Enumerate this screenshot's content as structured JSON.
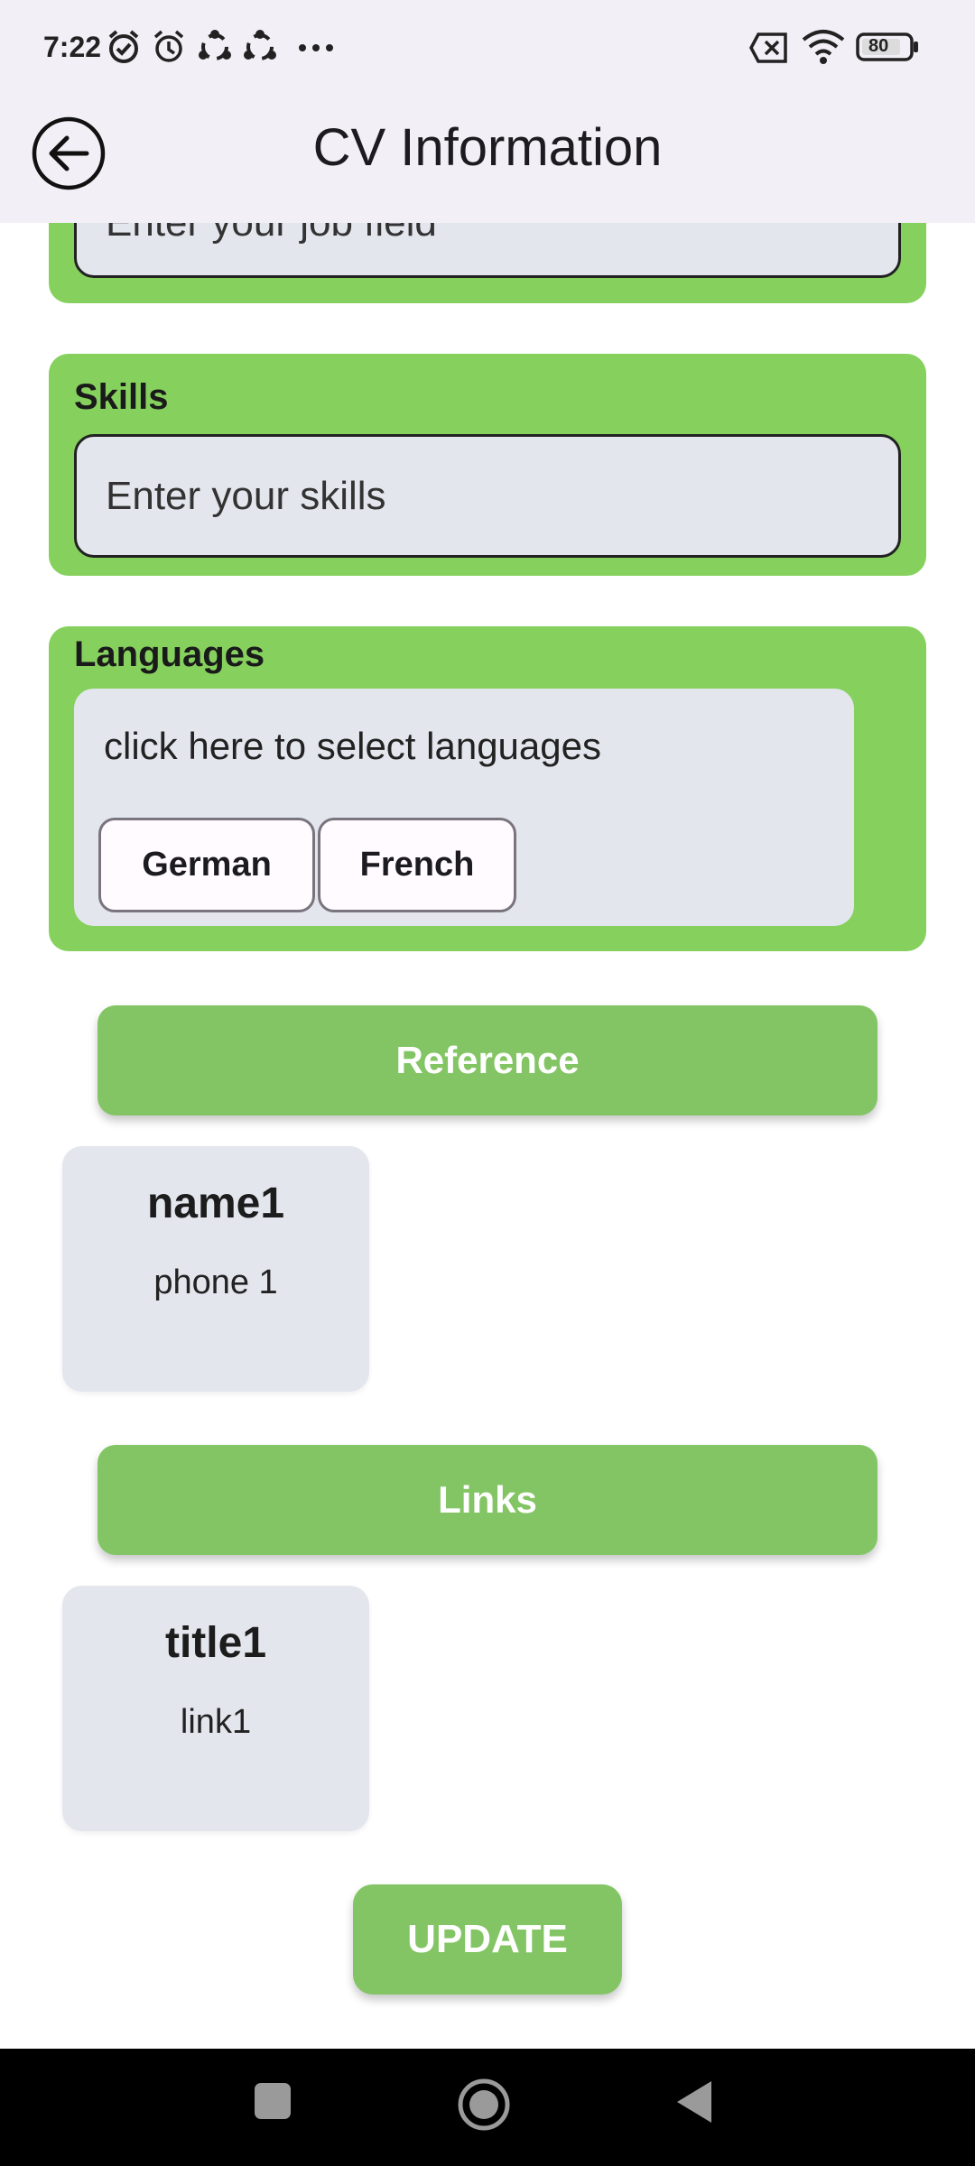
{
  "status_bar": {
    "time": "7:22",
    "left_icons": [
      "alarm-icon",
      "alarm-icon",
      "sync-icon",
      "sync-icon",
      "more-icon"
    ],
    "right_icons": [
      "sim-off-icon",
      "wifi-icon",
      "battery-icon"
    ],
    "battery_level": "80"
  },
  "app_bar": {
    "title": "CV Information",
    "back_icon": "arrow-back-icon"
  },
  "form": {
    "job_field": {
      "placeholder": "Enter your job field"
    },
    "skills": {
      "label": "Skills",
      "placeholder": "Enter your skills"
    },
    "languages": {
      "label": "Languages",
      "prompt": "click here to select languages",
      "selected": [
        "German",
        "French"
      ]
    }
  },
  "reference": {
    "button_label": "Reference",
    "items": [
      {
        "name": "name1",
        "phone": "phone 1"
      }
    ]
  },
  "links": {
    "button_label": "Links",
    "items": [
      {
        "title": "title1",
        "link": "link1"
      }
    ]
  },
  "update_label": "UPDATE",
  "nav_bar": {
    "icons": [
      "recents-icon",
      "home-icon",
      "back-triangle-icon"
    ]
  },
  "colors": {
    "accent": "#86d15e",
    "button": "#83c564",
    "field_bg": "#e4e6ee",
    "app_bar_bg": "#f2eff6"
  }
}
